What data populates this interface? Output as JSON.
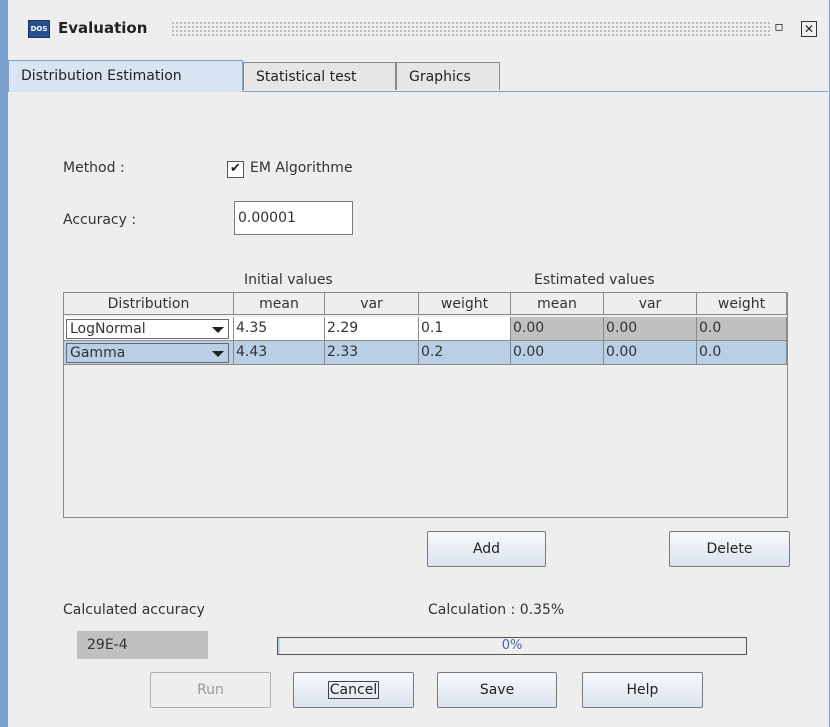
{
  "window": {
    "title": "Evaluation",
    "icon": "app-icon",
    "restore_glyph": "▫",
    "close_glyph": "✕"
  },
  "tabs": [
    {
      "label": "Distribution Estimation",
      "active": true
    },
    {
      "label": "Statistical test",
      "active": false
    },
    {
      "label": "Graphics",
      "active": false
    }
  ],
  "form": {
    "method_label": "Method :",
    "em_checkbox": {
      "label": "EM Algorithme",
      "checked": true
    },
    "accuracy_label": "Accuracy :",
    "accuracy_value": "0.00001"
  },
  "table": {
    "group_headers": {
      "initial": "Initial values",
      "estimated": "Estimated values"
    },
    "columns": [
      "Distribution",
      "mean",
      "var",
      "weight",
      "mean",
      "var",
      "weight"
    ],
    "rows": [
      {
        "distribution": "LogNormal",
        "init_mean": "4.35",
        "init_var": "2.29",
        "init_weight": "0.1",
        "est_mean": "0.00",
        "est_var": "0.00",
        "est_weight": "0.0"
      },
      {
        "distribution": "Gamma",
        "init_mean": "4.43",
        "init_var": "2.33",
        "init_weight": "0.2",
        "est_mean": "0.00",
        "est_var": "0.00",
        "est_weight": "0.0"
      }
    ]
  },
  "actions": {
    "add": "Add",
    "delete": "Delete"
  },
  "status": {
    "calculated_accuracy_label": "Calculated accuracy",
    "calculated_accuracy_value": "29E-4",
    "calculation_label": "Calculation : 0.35%",
    "progress_text": "0%",
    "progress_fraction": 0.0035
  },
  "footer": {
    "run": "Run",
    "cancel": "Cancel",
    "save": "Save",
    "help": "Help"
  },
  "colors": {
    "accent": "#7aa0cf",
    "selection": "#b8cfe5",
    "readonly": "#c0c0c0"
  }
}
